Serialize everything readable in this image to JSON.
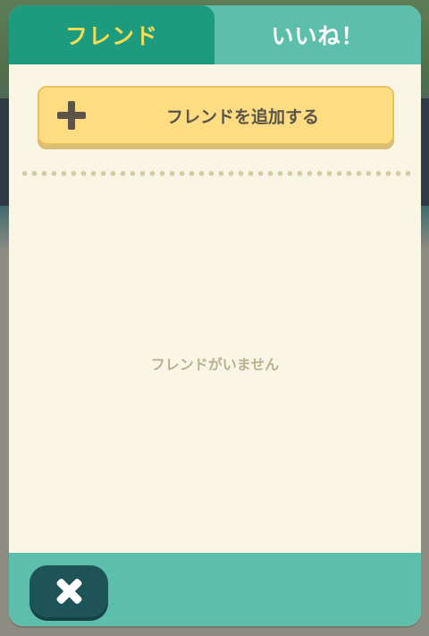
{
  "tabs": {
    "friends_label": "フレンド",
    "likes_label": "いいね！",
    "active": "friends"
  },
  "friends": {
    "add_button_label": "フレンドを追加する",
    "empty_message": "フレンドがいません"
  },
  "icons": {
    "add": "plus-icon",
    "close": "close-icon"
  },
  "colors": {
    "active_tab": "#1d9b7f",
    "active_tab_text": "#f5dc55",
    "tab_bar": "#5dbfab",
    "panel_background": "#faf6e6",
    "add_button": "#fddc82",
    "close_button": "#1e5458"
  }
}
